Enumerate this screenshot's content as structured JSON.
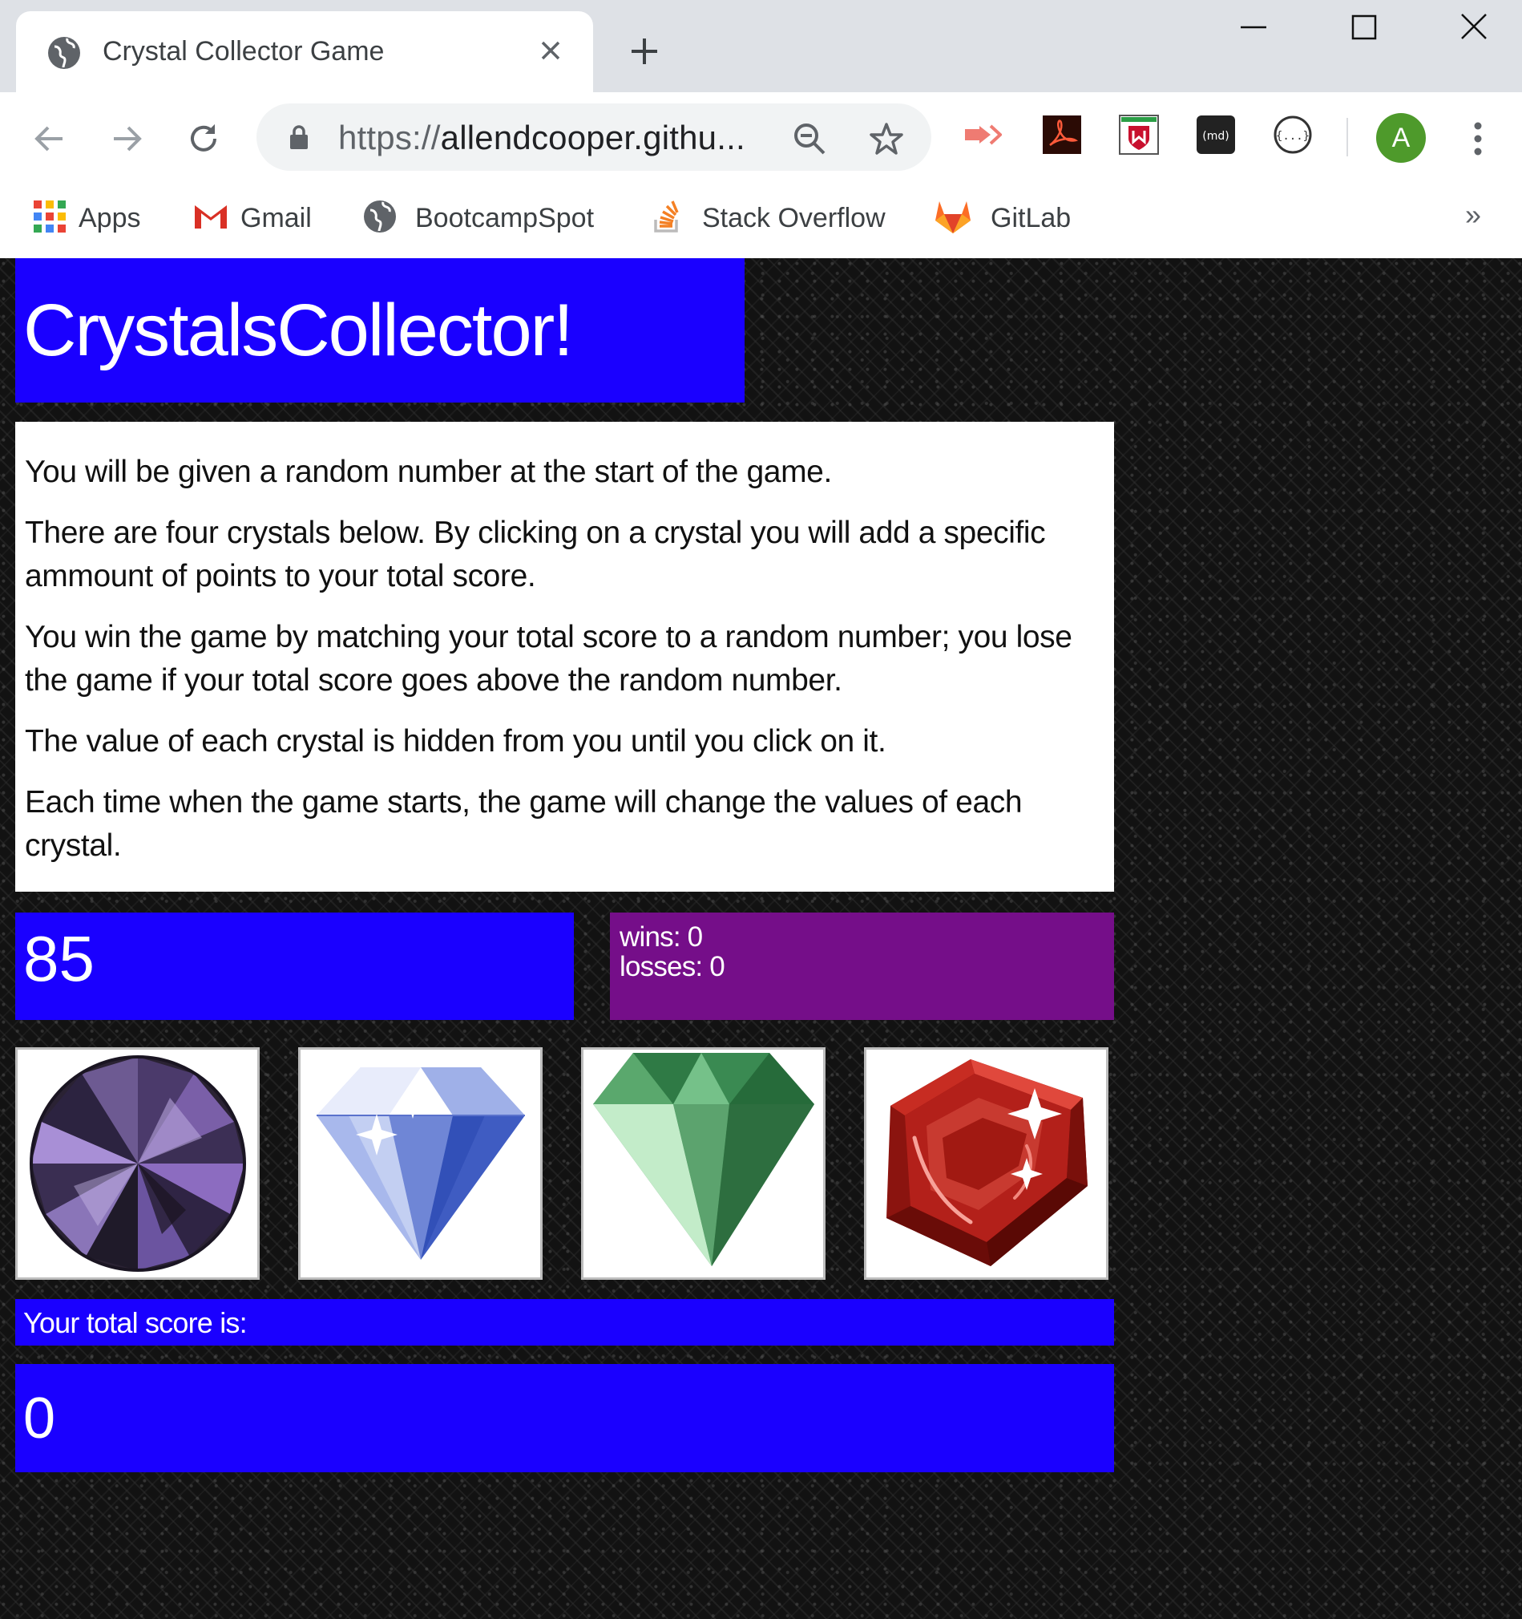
{
  "browser": {
    "tab_title": "Crystal Collector Game",
    "url_scheme": "https://",
    "url_host": "allendcooper.githu...",
    "avatar_letter": "A",
    "ext_md_label": "(md)",
    "ext_json_label": "{...}"
  },
  "bookmarks": {
    "items": [
      {
        "label": "Apps",
        "icon": "apps-grid-icon"
      },
      {
        "label": "Gmail",
        "icon": "gmail-icon"
      },
      {
        "label": "BootcampSpot",
        "icon": "globe-icon"
      },
      {
        "label": "Stack Overflow",
        "icon": "stack-overflow-icon"
      },
      {
        "label": "GitLab",
        "icon": "gitlab-icon"
      }
    ],
    "more": "»"
  },
  "game": {
    "title": "CrystalsCollector!",
    "instructions": [
      "You will be given a random number at the start of the game.",
      "There are four crystals below. By clicking on a crystal you will add a specific ammount of points to your total score.",
      "You win the game by matching your total score to a random number; you lose the game if your total score goes above the random number.",
      "The value of each crystal is hidden from you until you click on it.",
      "Each time when the game starts, the game will change the values of each crystal."
    ],
    "target_number": "85",
    "wins_label": "wins: 0",
    "losses_label": "losses: 0",
    "crystals": [
      {
        "name": "purple-round-crystal",
        "color": "#5b3d8c"
      },
      {
        "name": "clear-diamond",
        "color": "#8fa3e0"
      },
      {
        "name": "green-emerald",
        "color": "#3f8f55"
      },
      {
        "name": "red-ruby",
        "color": "#b3201a"
      }
    ],
    "score_label": "Your total score is:",
    "total_score": "0"
  },
  "colors": {
    "panel_blue": "#1a00ff",
    "record_purple": "#750e89",
    "background": "#121212"
  }
}
